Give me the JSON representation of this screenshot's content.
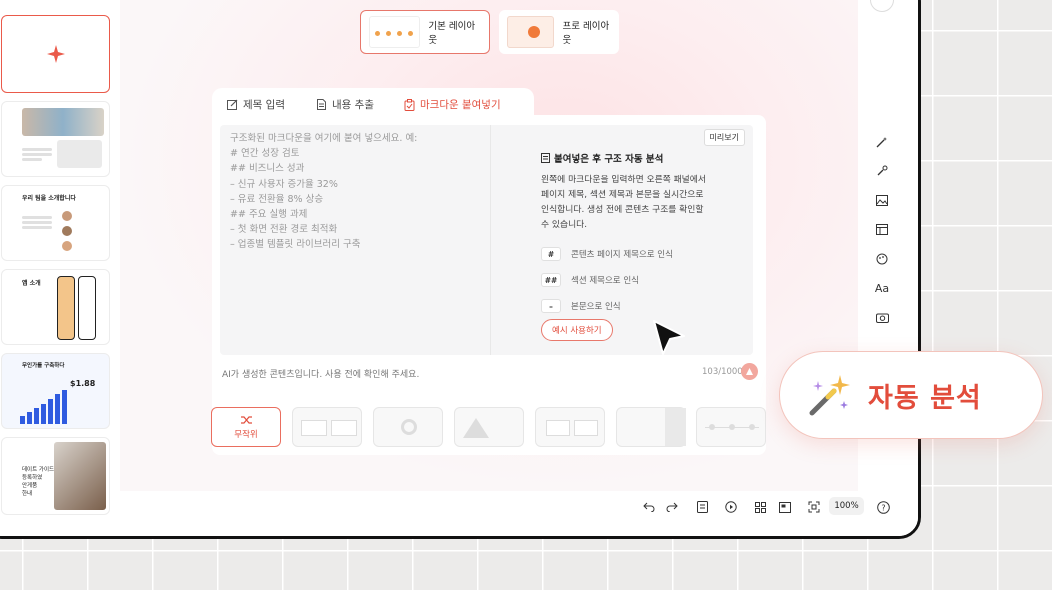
{
  "layouts": [
    {
      "label": "기본 레이아웃",
      "selected": true
    },
    {
      "label": "프로 레이아웃",
      "selected": false
    }
  ],
  "tabs": [
    {
      "label": "제목 입력",
      "icon": "edit-icon",
      "active": false
    },
    {
      "label": "내용 추출",
      "icon": "document-icon",
      "active": false
    },
    {
      "label": "마크다운 붙여넣기",
      "icon": "clipboard-icon",
      "active": true
    }
  ],
  "editor": {
    "placeholder": "구조화된 마크다운을 여기에 붙여 넣으세요. 예:\n# 연간 성장 검토\n## 비즈니스 성과\n– 신규 사용자 증가율 32%\n– 유료 전환율 8% 상승\n## 주요 실행 과제\n– 첫 화면 전환 경로 최적화\n– 업종별 템플릿 라이브러리 구축",
    "preview_label": "미리보기",
    "panel_title": "붙여넣은 후 구조 자동 분석",
    "panel_desc": "왼쪽에 마크다운을 입력하면 오른쪽 패널에서\n페이지 제목, 섹션 제목과 본문을 실시간으로\n인식합니다. 생성 전에 콘텐츠 구조를 확인할\n수 있습니다.",
    "rules": [
      {
        "mark": "#",
        "text": "콘텐츠 페이지 제목으로 인식"
      },
      {
        "mark": "##",
        "text": "섹션 제목으로 인식"
      },
      {
        "mark": "–",
        "text": "본문으로 인식"
      }
    ],
    "example_button": "예시 사용하기",
    "footer_note": "AI가 생성한 콘텐츠입니다. 사용 전에 확인해 주세요.",
    "counter": "103/1000"
  },
  "templates": {
    "random_label": "무작위",
    "count": 7
  },
  "slides_thumbs": [
    {
      "text": ""
    },
    {
      "text": ""
    },
    {
      "text": "우리 팀을 소개합니다"
    },
    {
      "text": "앱 소개"
    },
    {
      "text": "무인가를 구축하다",
      "number": "$1.88"
    },
    {
      "text": "데이트 가이드\n등록하였\n안게품\n한내"
    }
  ],
  "bottom_bar": {
    "zoom": "100%"
  },
  "rail_icons": [
    "magic-wand-icon",
    "sparkle-pen-icon",
    "image-icon",
    "layout-icon",
    "palette-icon",
    "text-icon",
    "camera-icon"
  ],
  "rail_text_label": "Aa",
  "callout": {
    "label": "자동 분석",
    "icon": "magic-wand-icon"
  },
  "colors": {
    "accent": "#e24d3c",
    "accent_light": "#f2a79e"
  }
}
